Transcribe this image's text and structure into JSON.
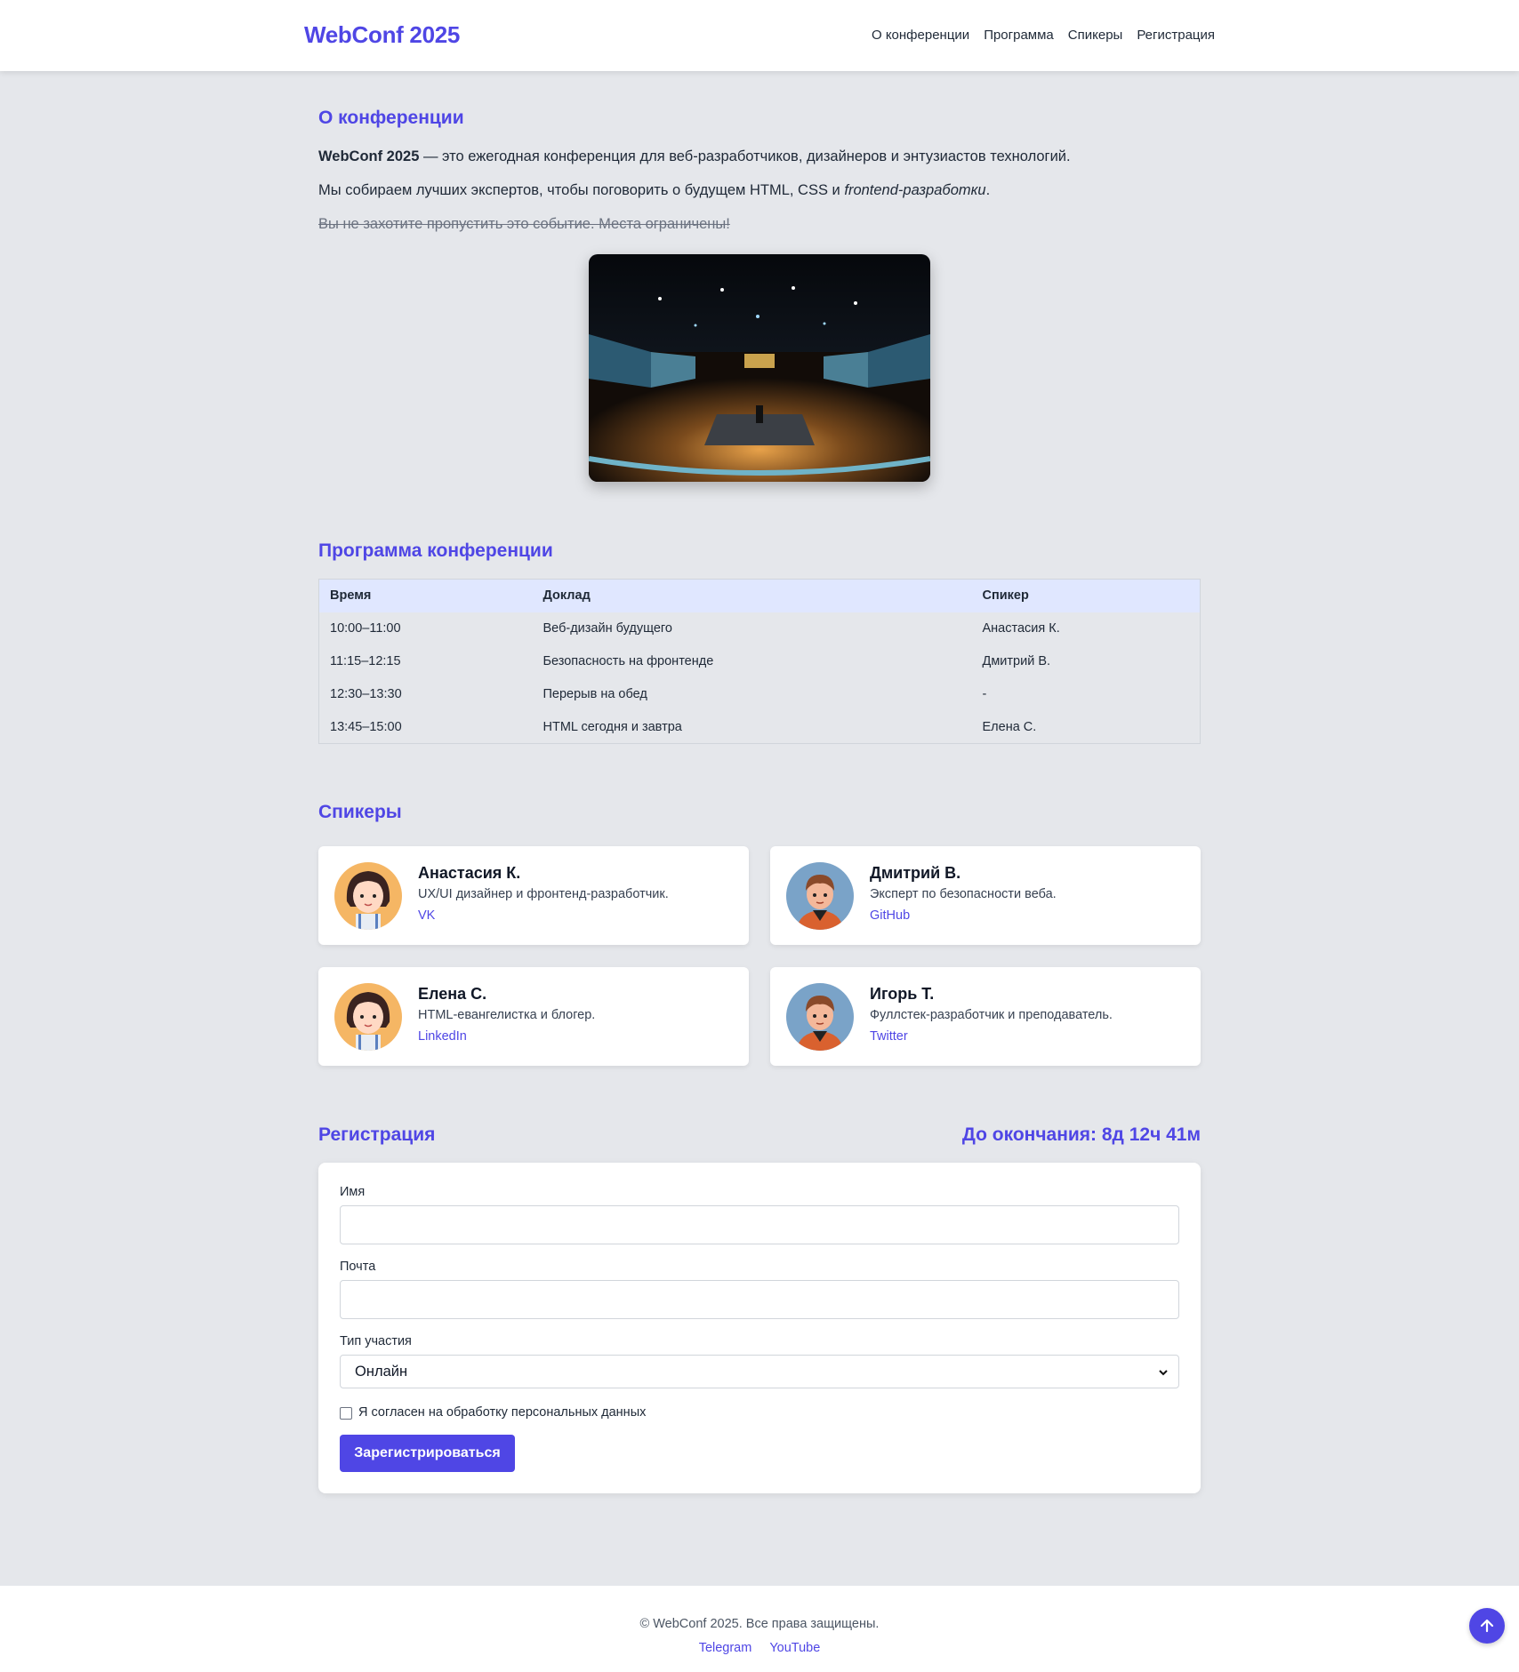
{
  "header": {
    "logo": "WebConf 2025",
    "nav": [
      "О конференции",
      "Программа",
      "Спикеры",
      "Регистрация"
    ]
  },
  "about": {
    "title": "О конференции",
    "p1_bold": "WebConf 2025",
    "p1_rest": " — это ежегодная конференция для веб-разработчиков, дизайнеров и энтузиастов технологий.",
    "p2_start": "Мы собираем лучших экспертов, чтобы поговорить о будущем HTML, CSS и ",
    "p2_italic": "frontend-разработки",
    "p2_end": ".",
    "p3_struck": "Вы не захотите пропустить это событие. Места ограничены!"
  },
  "schedule": {
    "title": "Программа конференции",
    "headers": [
      "Время",
      "Доклад",
      "Спикер"
    ],
    "rows": [
      [
        "10:00–11:00",
        "Веб-дизайн будущего",
        "Анастасия К."
      ],
      [
        "11:15–12:15",
        "Безопасность на фронтенде",
        "Дмитрий В."
      ],
      [
        "12:30–13:30",
        "Перерыв на обед",
        "-"
      ],
      [
        "13:45–15:00",
        "HTML сегодня и завтра",
        "Елена С."
      ]
    ]
  },
  "speakers": {
    "title": "Спикеры",
    "items": [
      {
        "name": "Анастасия К.",
        "role": "UX/UI дизайнер и фронтенд-разработчик.",
        "link": "VK",
        "avatar": "female"
      },
      {
        "name": "Дмитрий В.",
        "role": "Эксперт по безопасности веба.",
        "link": "GitHub",
        "avatar": "male"
      },
      {
        "name": "Елена С.",
        "role": "HTML-евангелистка и блогер.",
        "link": "LinkedIn",
        "avatar": "female"
      },
      {
        "name": "Игорь Т.",
        "role": "Фуллстек-разработчик и преподаватель.",
        "link": "Twitter",
        "avatar": "male"
      }
    ]
  },
  "registration": {
    "title": "Регистрация",
    "countdown": "До окончания: 8д 12ч 41м",
    "name_label": "Имя",
    "email_label": "Почта",
    "type_label": "Тип участия",
    "type_value": "Онлайн",
    "consent_label": "Я согласен на обработку персональных данных",
    "submit_label": "Зарегистрироваться"
  },
  "footer": {
    "copyright": "© WebConf 2025. Все права защищены.",
    "links": [
      "Telegram",
      "YouTube"
    ]
  },
  "colors": {
    "accent": "#4f46e5",
    "background": "#e5e7eb",
    "table_header": "#e0e7ff"
  }
}
